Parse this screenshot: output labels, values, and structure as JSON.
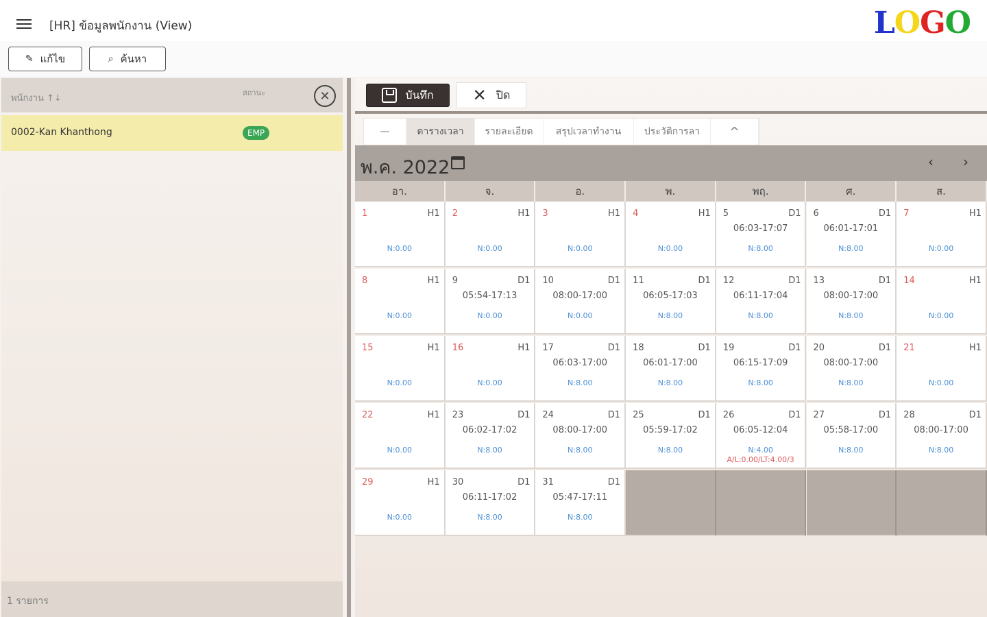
{
  "header": {
    "title": "[HR] ข้อมูลพนักงาน (View)",
    "logo": {
      "l": "L",
      "o1": "O",
      "g": "G",
      "o2": "O"
    }
  },
  "toolbar": {
    "edit_label": "แก้ไข",
    "search_label": "ค้นหา"
  },
  "employee_list": {
    "col_employee": "พนักงาน ↑↓",
    "col_status": "สถานะ",
    "rows": [
      {
        "name": "0002-Kan Khanthong",
        "status": "EMP"
      }
    ],
    "footer": "1 รายการ"
  },
  "detail": {
    "save_label": "บันทึก",
    "close_label": "ปิด",
    "tabs": [
      "—",
      "ตารางเวลา",
      "รายละเอียด",
      "สรุปเวลาทำงาน",
      "ประวัติการลา",
      "^"
    ],
    "active_tab": 1
  },
  "calendar": {
    "month_label": "พ.ค. 2022",
    "weekdays": [
      "อา.",
      "จ.",
      "อ.",
      "พ.",
      "พฤ.",
      "ศ.",
      "ส."
    ],
    "days": [
      {
        "d": "1",
        "code": "H1",
        "time": "",
        "ot": "N:0.00",
        "red": true
      },
      {
        "d": "2",
        "code": "H1",
        "time": "",
        "ot": "N:0.00",
        "red": true
      },
      {
        "d": "3",
        "code": "H1",
        "time": "",
        "ot": "N:0.00",
        "red": true
      },
      {
        "d": "4",
        "code": "H1",
        "time": "",
        "ot": "N:0.00",
        "red": true
      },
      {
        "d": "5",
        "code": "D1",
        "time": "06:03-17:07",
        "ot": "N:8.00",
        "red": false
      },
      {
        "d": "6",
        "code": "D1",
        "time": "06:01-17:01",
        "ot": "N:8.00",
        "red": false
      },
      {
        "d": "7",
        "code": "H1",
        "time": "",
        "ot": "N:0.00",
        "red": true
      },
      {
        "d": "8",
        "code": "H1",
        "time": "",
        "ot": "N:0.00",
        "red": true
      },
      {
        "d": "9",
        "code": "D1",
        "time": "05:54-17:13",
        "ot": "N:0.00",
        "red": false
      },
      {
        "d": "10",
        "code": "D1",
        "time": "08:00-17:00",
        "ot": "N:0.00",
        "red": false
      },
      {
        "d": "11",
        "code": "D1",
        "time": "06:05-17:03",
        "ot": "N:8.00",
        "red": false
      },
      {
        "d": "12",
        "code": "D1",
        "time": "06:11-17:04",
        "ot": "N:8.00",
        "red": false
      },
      {
        "d": "13",
        "code": "D1",
        "time": "08:00-17:00",
        "ot": "N:8.00",
        "red": false
      },
      {
        "d": "14",
        "code": "H1",
        "time": "",
        "ot": "N:0.00",
        "red": true
      },
      {
        "d": "15",
        "code": "H1",
        "time": "",
        "ot": "N:0.00",
        "red": true
      },
      {
        "d": "16",
        "code": "H1",
        "time": "",
        "ot": "N:0.00",
        "red": true
      },
      {
        "d": "17",
        "code": "D1",
        "time": "06:03-17:00",
        "ot": "N:8.00",
        "red": false
      },
      {
        "d": "18",
        "code": "D1",
        "time": "06:01-17:00",
        "ot": "N:8.00",
        "red": false
      },
      {
        "d": "19",
        "code": "D1",
        "time": "06:15-17:09",
        "ot": "N:8.00",
        "red": false
      },
      {
        "d": "20",
        "code": "D1",
        "time": "08:00-17:00",
        "ot": "N:8.00",
        "red": false
      },
      {
        "d": "21",
        "code": "H1",
        "time": "",
        "ot": "N:0.00",
        "red": true
      },
      {
        "d": "22",
        "code": "H1",
        "time": "",
        "ot": "N:0.00",
        "red": true
      },
      {
        "d": "23",
        "code": "D1",
        "time": "06:02-17:02",
        "ot": "N:8.00",
        "red": false
      },
      {
        "d": "24",
        "code": "D1",
        "time": "08:00-17:00",
        "ot": "N:8.00",
        "red": false
      },
      {
        "d": "25",
        "code": "D1",
        "time": "05:59-17:02",
        "ot": "N:8.00",
        "red": false
      },
      {
        "d": "26",
        "code": "D1",
        "time": "06:05-12:04",
        "ot": "N:4.00",
        "leave": "A/L:0.00/LT:4.00/3",
        "red": false
      },
      {
        "d": "27",
        "code": "D1",
        "time": "05:58-17:00",
        "ot": "N:8.00",
        "red": false
      },
      {
        "d": "28",
        "code": "D1",
        "time": "08:00-17:00",
        "ot": "N:8.00",
        "red": false
      },
      {
        "d": "29",
        "code": "H1",
        "time": "",
        "ot": "N:0.00",
        "red": true
      },
      {
        "d": "30",
        "code": "D1",
        "time": "06:11-17:02",
        "ot": "N:8.00",
        "red": false
      },
      {
        "d": "31",
        "code": "D1",
        "time": "05:47-17:11",
        "ot": "N:8.00",
        "red": false
      }
    ]
  }
}
